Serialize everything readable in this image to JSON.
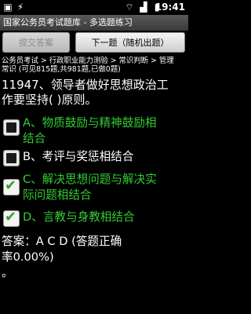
{
  "status_bar": {
    "icons": [
      "app-notification-icon",
      "usb-icon",
      "wifi-icon",
      "signal-icon",
      "battery-icon"
    ],
    "time": "19:41"
  },
  "title": "国家公务员考试题库 - 多选题练习",
  "buttons": {
    "submit": "提交答案",
    "next": "下一题（随机出题）"
  },
  "breadcrumb": {
    "line1": "公务员考试 > 行政职业能力测验 > 常识判断 > 管理",
    "line2": "常识 (可见815题,共981题,已做0题)"
  },
  "question": {
    "line1": "11947、领导者做好思想政治工",
    "line2": "作要坚持(    )原则。"
  },
  "options": [
    {
      "lines": [
        "A、物质鼓励与精神鼓励相",
        "结合"
      ],
      "checked": false,
      "correct": true
    },
    {
      "lines": [
        "B、考评与奖惩相结合"
      ],
      "checked": false,
      "correct": false
    },
    {
      "lines": [
        "C、解决思想问题与解决实",
        "际问题相结合"
      ],
      "checked": true,
      "correct": true
    },
    {
      "lines": [
        "D、言教与身教相结合"
      ],
      "checked": true,
      "correct": true
    }
  ],
  "answer": {
    "line1": "答案：A C D (答题正确",
    "line2": "率0.00%)",
    "line3": "。"
  },
  "colors": {
    "correct_text": "#33cc33",
    "tick": "#2e9e2e",
    "background": "#000000"
  }
}
